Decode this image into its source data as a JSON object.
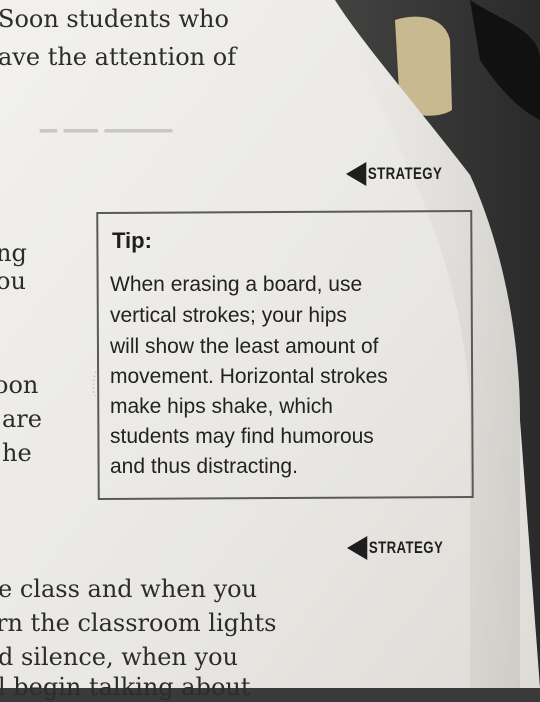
{
  "top_text": [
    "Soon students who",
    "ave the attention of"
  ],
  "left_fragments": [
    "ng",
    "ou",
    "oon",
    "are",
    "he"
  ],
  "strategy_label": "STRATEGY",
  "tip": {
    "title": "Tip:",
    "lines": [
      "When erasing a board, use",
      "vertical strokes; your hips",
      "will show the least amount of",
      "movement. Horizontal strokes",
      "make hips shake, which",
      "students may find humorous",
      "and thus distracting."
    ]
  },
  "bottom_text": [
    "e class and when you",
    "rn the classroom lights",
    "d silence, when you",
    "l begin talking about"
  ],
  "colors": {
    "paper": "#ecebe8",
    "background": "#3a3a3a",
    "tape": "#d9c89a",
    "ink": "#1e1e1e"
  }
}
